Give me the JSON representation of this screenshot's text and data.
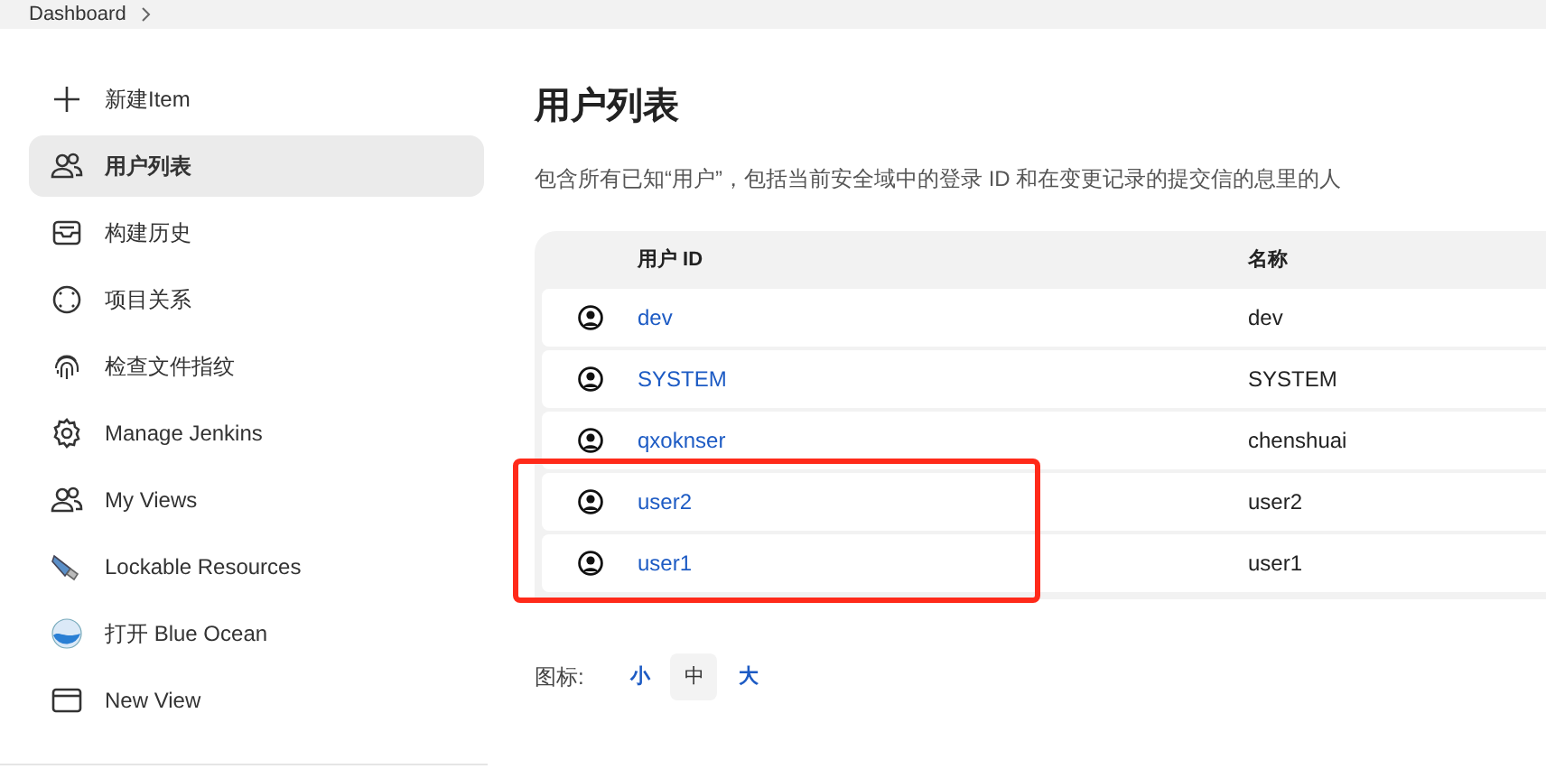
{
  "breadcrumb": {
    "items": [
      "Dashboard"
    ]
  },
  "sidebar": {
    "items": [
      {
        "label": "新建Item",
        "selected": false
      },
      {
        "label": "用户列表",
        "selected": true
      },
      {
        "label": "构建历史",
        "selected": false
      },
      {
        "label": "项目关系",
        "selected": false
      },
      {
        "label": "检查文件指纹",
        "selected": false
      },
      {
        "label": "Manage Jenkins",
        "selected": false
      },
      {
        "label": "My Views",
        "selected": false
      },
      {
        "label": "Lockable Resources",
        "selected": false
      },
      {
        "label": "打开 Blue Ocean",
        "selected": false
      },
      {
        "label": "New View",
        "selected": false
      }
    ]
  },
  "title": "用户列表",
  "description": "包含所有已知“用户”，包括当前安全域中的登录 ID 和在变更记录的提交信的息里的人",
  "table": {
    "columns": [
      "用户 ID",
      "名称"
    ],
    "rows": [
      {
        "user_id": "dev",
        "name": "dev",
        "highlighted": false
      },
      {
        "user_id": "SYSTEM",
        "name": "SYSTEM",
        "highlighted": false
      },
      {
        "user_id": "qxoknser",
        "name": "chenshuai",
        "highlighted": false
      },
      {
        "user_id": "user2",
        "name": "user2",
        "highlighted": true
      },
      {
        "user_id": "user1",
        "name": "user1",
        "highlighted": true
      }
    ]
  },
  "icon_size": {
    "label": "图标:",
    "options": [
      {
        "label": "小",
        "selected": false
      },
      {
        "label": "中",
        "selected": true
      },
      {
        "label": "大",
        "selected": false
      }
    ]
  }
}
